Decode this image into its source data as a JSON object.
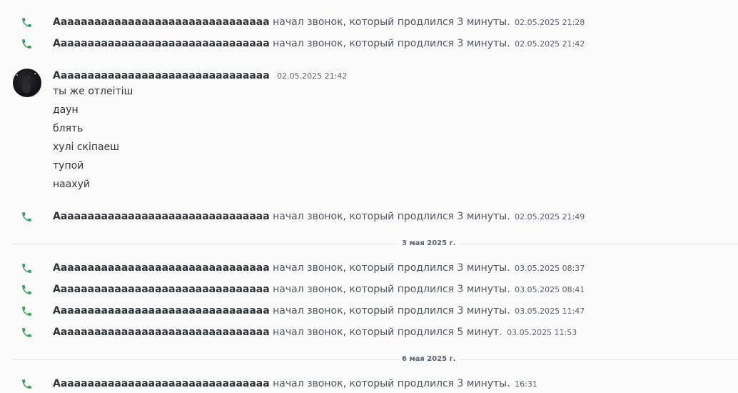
{
  "colors": {
    "call_icon": "#3ba55d",
    "divider": "#e3e5e8"
  },
  "icons": {
    "call": "phone-call-icon"
  },
  "author": "Аааааааааааааааааааааааааааааааа",
  "calls_top": [
    {
      "author": "Аааааааааааааааааааааааааааааааа",
      "action": "начал звонок, который продлился 3 минуты.",
      "time": "02.05.2025 21:28"
    },
    {
      "author": "Аааааааааааааааааааааааааааааааа",
      "action": "начал звонок, который продлился 3 минуты.",
      "time": "02.05.2025 21:42"
    }
  ],
  "message": {
    "author": "Аааааааааааааааааааааааааааааааа",
    "time": "02.05.2025 21:42",
    "lines": [
      "ты же отлеітіш",
      "даун",
      "блять",
      "хулі скіпаеш",
      "тупой",
      "наахуй"
    ]
  },
  "call_after_message": {
    "author": "Аааааааааааааааааааааааааааааааа",
    "action": "начал звонок, который продлился 3 минуты.",
    "time": "02.05.2025 21:49"
  },
  "divider_may3": "3 мая 2025 г.",
  "calls_may3": [
    {
      "author": "Аааааааааааааааааааааааааааааааа",
      "action": "начал звонок, который продлился 3 минуты.",
      "time": "03.05.2025 08:37"
    },
    {
      "author": "Аааааааааааааааааааааааааааааааа",
      "action": "начал звонок, который продлился 3 минуты.",
      "time": "03.05.2025 08:41"
    },
    {
      "author": "Аааааааааааааааааааааааааааааааа",
      "action": "начал звонок, который продлился 3 минуты.",
      "time": "03.05.2025 11:47"
    },
    {
      "author": "Аааааааааааааааааааааааааааааааа",
      "action": "начал звонок, который продлился 5 минут.",
      "time": "03.05.2025 11:53"
    }
  ],
  "divider_may6": "6 мая 2025 г.",
  "calls_may6": [
    {
      "author": "Аааааааааааааааааааааааааааааааа",
      "action": "начал звонок, который продлился 3 минуты.",
      "time": "16:31"
    }
  ]
}
